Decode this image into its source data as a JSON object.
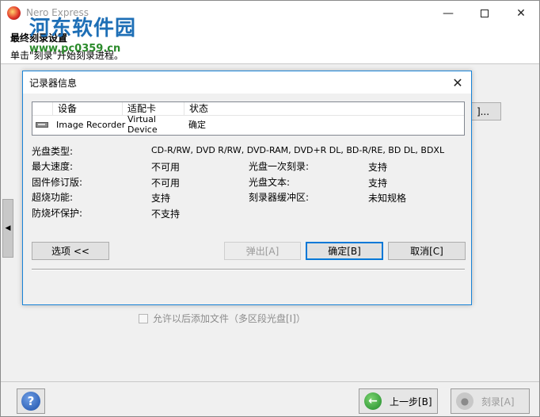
{
  "app": {
    "title": "Nero Express",
    "heading": "最终刻录设置",
    "subtitle": "单击\"刻录\"开始刻录进程。"
  },
  "watermark": {
    "title": "河东软件园",
    "url": "www.pc0359.cn"
  },
  "window_controls": {
    "minimize": "—",
    "close": "✕"
  },
  "behind": {
    "button_label": "]...",
    "multisession_label": "允许以后添加文件（多区段光盘[I]）",
    "multisession_checked": false
  },
  "footer": {
    "help_icon": "?",
    "back_label": "上一步[B]",
    "burn_label": "刻录[A]"
  },
  "dialog": {
    "title": "记录器信息",
    "close": "✕",
    "columns": [
      "设备",
      "适配卡",
      "状态"
    ],
    "rows": [
      {
        "device": "Image Recorder",
        "adapter": "Virtual Device",
        "status": "确定"
      }
    ],
    "info": {
      "disc_type_label": "光盘类型:",
      "disc_type_value": "CD-R/RW, DVD R/RW, DVD-RAM, DVD+R DL, BD-R/RE, BD DL, BDXL",
      "max_speed_label": "最大速度:",
      "max_speed_value": "不可用",
      "firmware_label": "固件修订版:",
      "firmware_value": "不可用",
      "overburn_label": "超烧功能:",
      "overburn_value": "支持",
      "underrun_label": "防烧坏保护:",
      "underrun_value": "不支持",
      "dao_label": "光盘一次刻录:",
      "dao_value": "支持",
      "cdtext_label": "光盘文本:",
      "cdtext_value": "支持",
      "buffer_label": "刻录器缓冲区:",
      "buffer_value": "未知规格"
    },
    "buttons": {
      "options": "选项 <<",
      "eject": "弹出[A]",
      "ok": "确定[B]",
      "cancel": "取消[C]"
    }
  }
}
